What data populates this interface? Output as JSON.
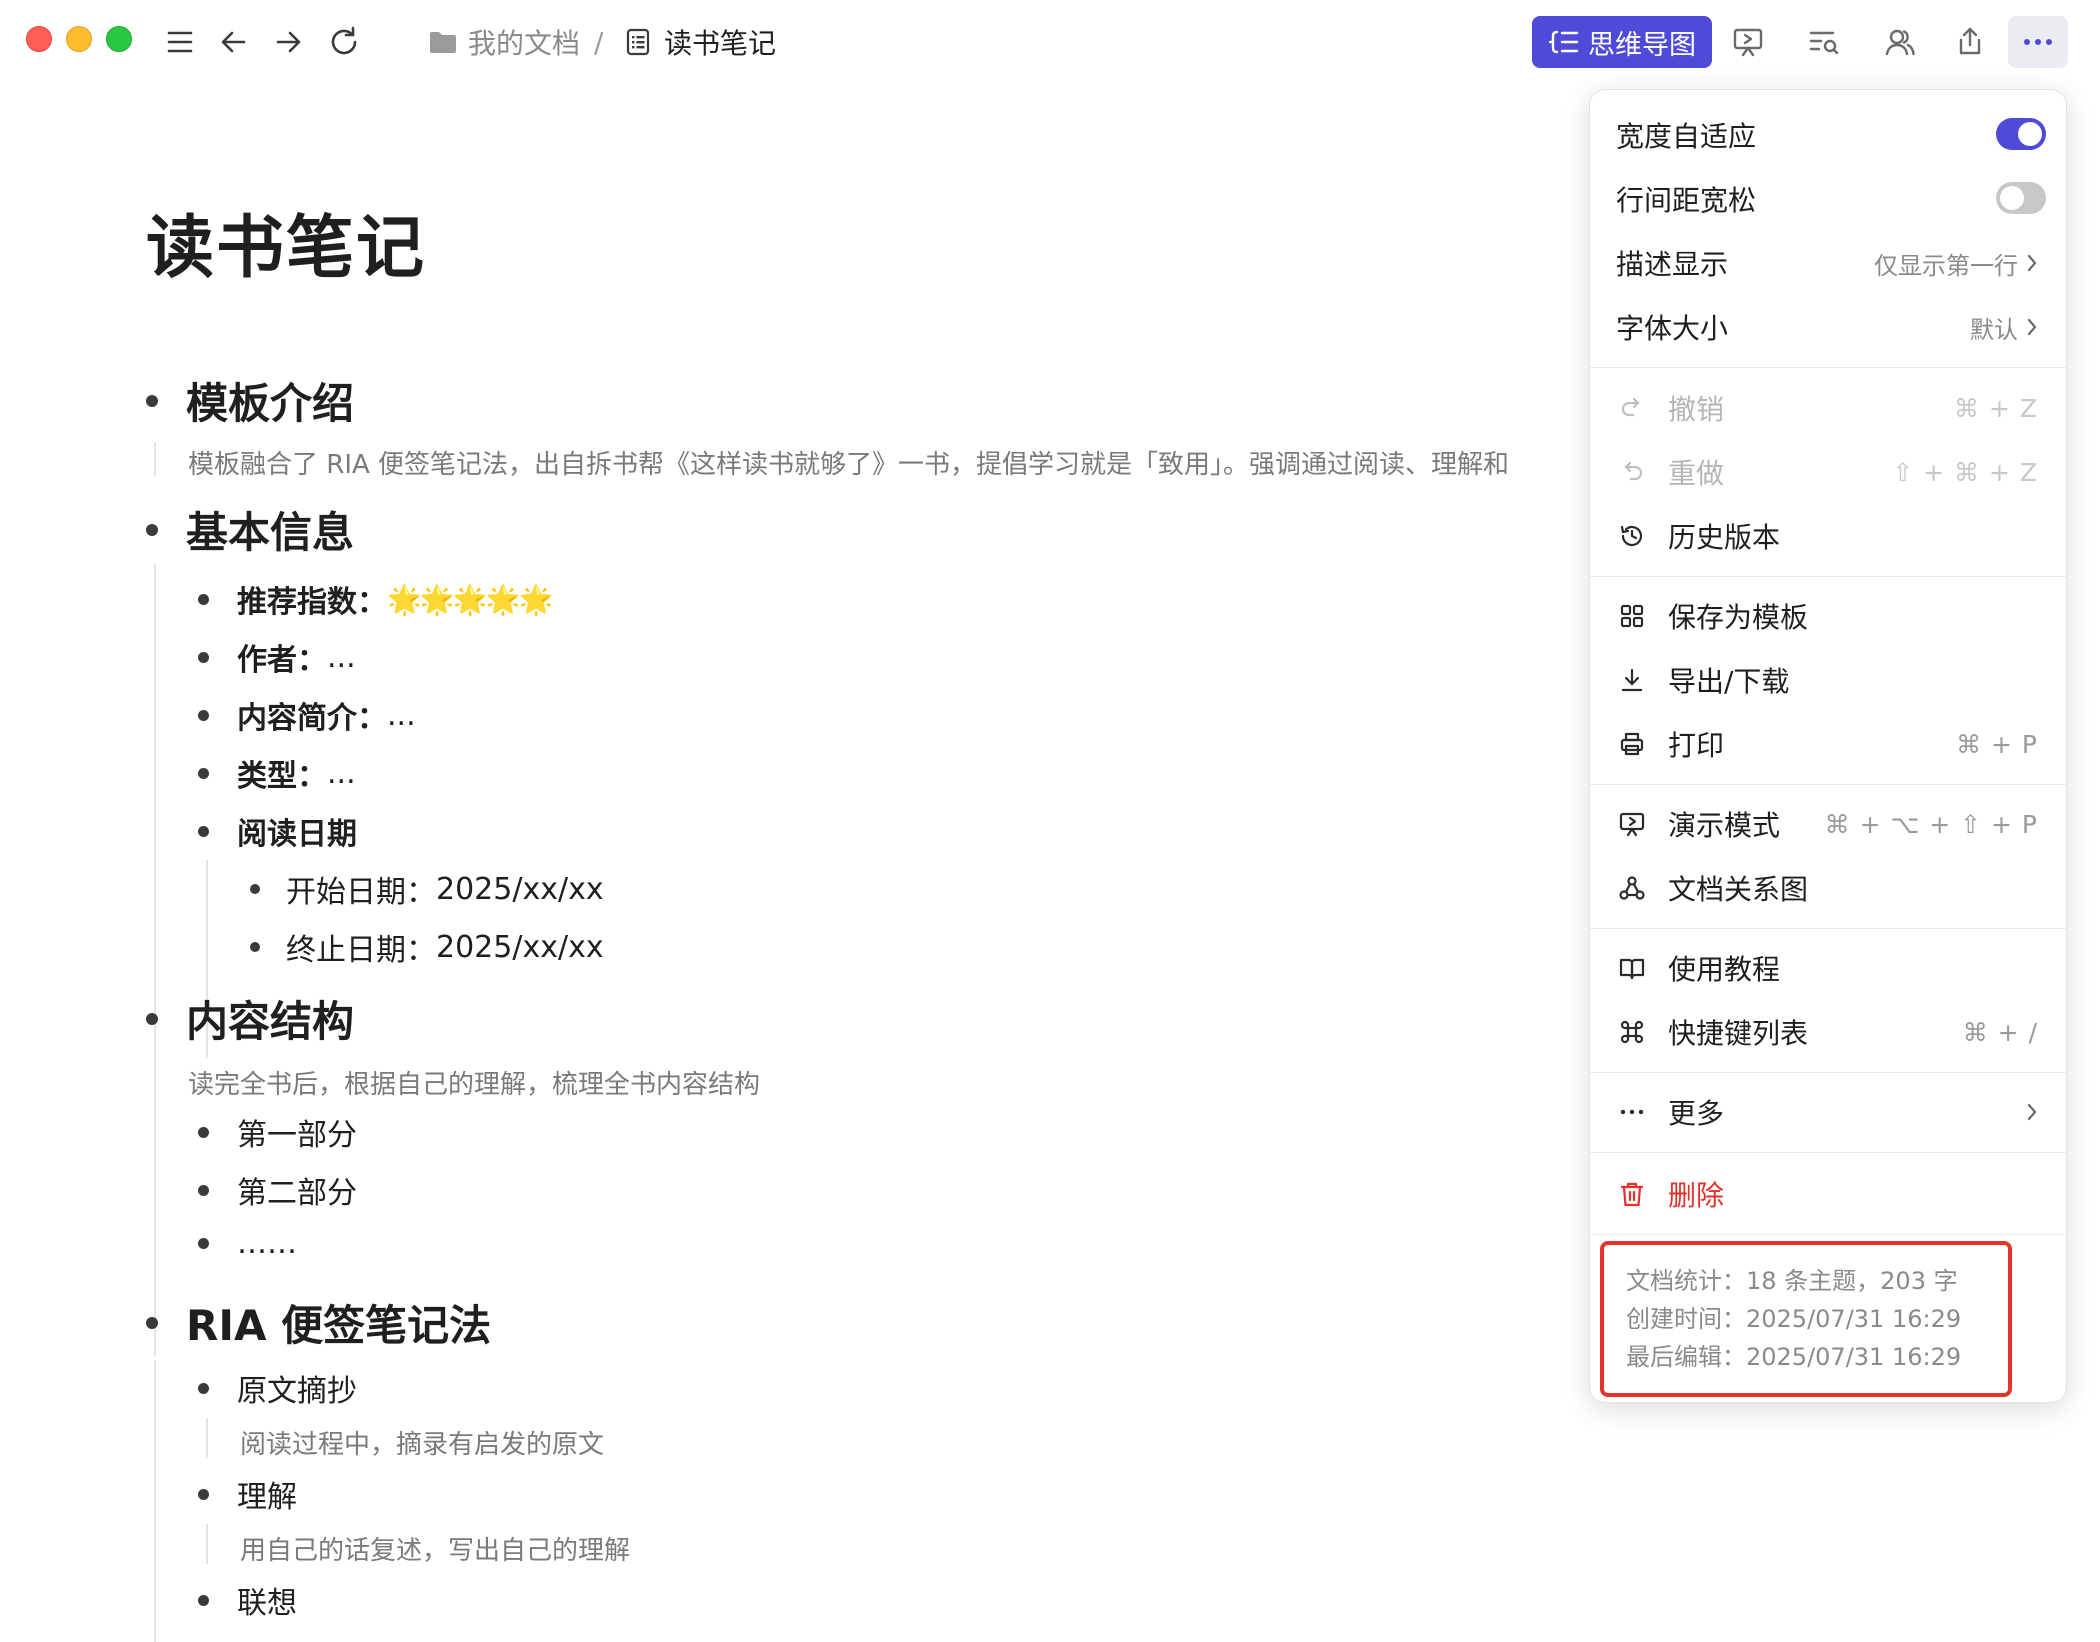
{
  "window": {
    "title": "读书笔记"
  },
  "breadcrumb": {
    "root": "我的文档",
    "separator": "/",
    "current": "读书笔记"
  },
  "toolbar": {
    "mindmap_label": "思维导图",
    "accent": "#4f4bd9"
  },
  "doc": {
    "title": "读书笔记",
    "sections": [
      {
        "heading": "模板介绍",
        "description": "模板融合了 RIA 便签笔记法，出自拆书帮《这样读书就够了》一书，提倡学习就是「致用」。强调通过阅读、理解和"
      },
      {
        "heading": "基本信息",
        "items": [
          {
            "label": "推荐指数：",
            "value": "🌟🌟🌟🌟🌟"
          },
          {
            "label": "作者：",
            "value": "..."
          },
          {
            "label": "内容简介：",
            "value": "..."
          },
          {
            "label": "类型：",
            "value": "..."
          },
          {
            "label": "阅读日期",
            "value": ""
          }
        ],
        "dates": [
          {
            "label": "开始日期：",
            "value": "2025/xx/xx"
          },
          {
            "label": "终止日期：",
            "value": "2025/xx/xx"
          }
        ]
      },
      {
        "heading": "内容结构",
        "description": "读完全书后，根据自己的理解，梳理全书内容结构",
        "items": [
          "第一部分",
          "第二部分",
          "……"
        ]
      },
      {
        "heading": "RIA 便签笔记法",
        "items": [
          {
            "label": "原文摘抄",
            "description": "阅读过程中，摘录有启发的原文"
          },
          {
            "label": "理解",
            "description": "用自己的话复述，写出自己的理解"
          },
          {
            "label": "联想",
            "description": ""
          }
        ]
      }
    ]
  },
  "menu": {
    "width_adaptive": {
      "label": "宽度自适应",
      "on": true
    },
    "loose_spacing": {
      "label": "行间距宽松",
      "on": false
    },
    "description_display": {
      "label": "描述显示",
      "value": "仅显示第一行"
    },
    "font_size": {
      "label": "字体大小",
      "value": "默认"
    },
    "undo": {
      "label": "撤销",
      "shortcut": "⌘ + Z"
    },
    "redo": {
      "label": "重做",
      "shortcut": "⇧ + ⌘ + Z"
    },
    "history": {
      "label": "历史版本"
    },
    "save_template": {
      "label": "保存为模板"
    },
    "export": {
      "label": "导出/下载"
    },
    "print": {
      "label": "打印",
      "shortcut": "⌘ + P"
    },
    "presentation": {
      "label": "演示模式",
      "shortcut": "⌘ + ⌥ + ⇧ + P"
    },
    "relation_graph": {
      "label": "文档关系图"
    },
    "tutorial": {
      "label": "使用教程"
    },
    "shortcuts": {
      "label": "快捷键列表",
      "shortcut": "⌘ + /"
    },
    "more": {
      "label": "更多"
    },
    "delete": {
      "label": "删除",
      "color": "#e0322b"
    },
    "stats": {
      "doc_stats": "文档统计：18 条主题，203 字",
      "created": "创建时间：2025/07/31 16:29",
      "last_edit": "最后编辑：2025/07/31 16:29"
    }
  }
}
